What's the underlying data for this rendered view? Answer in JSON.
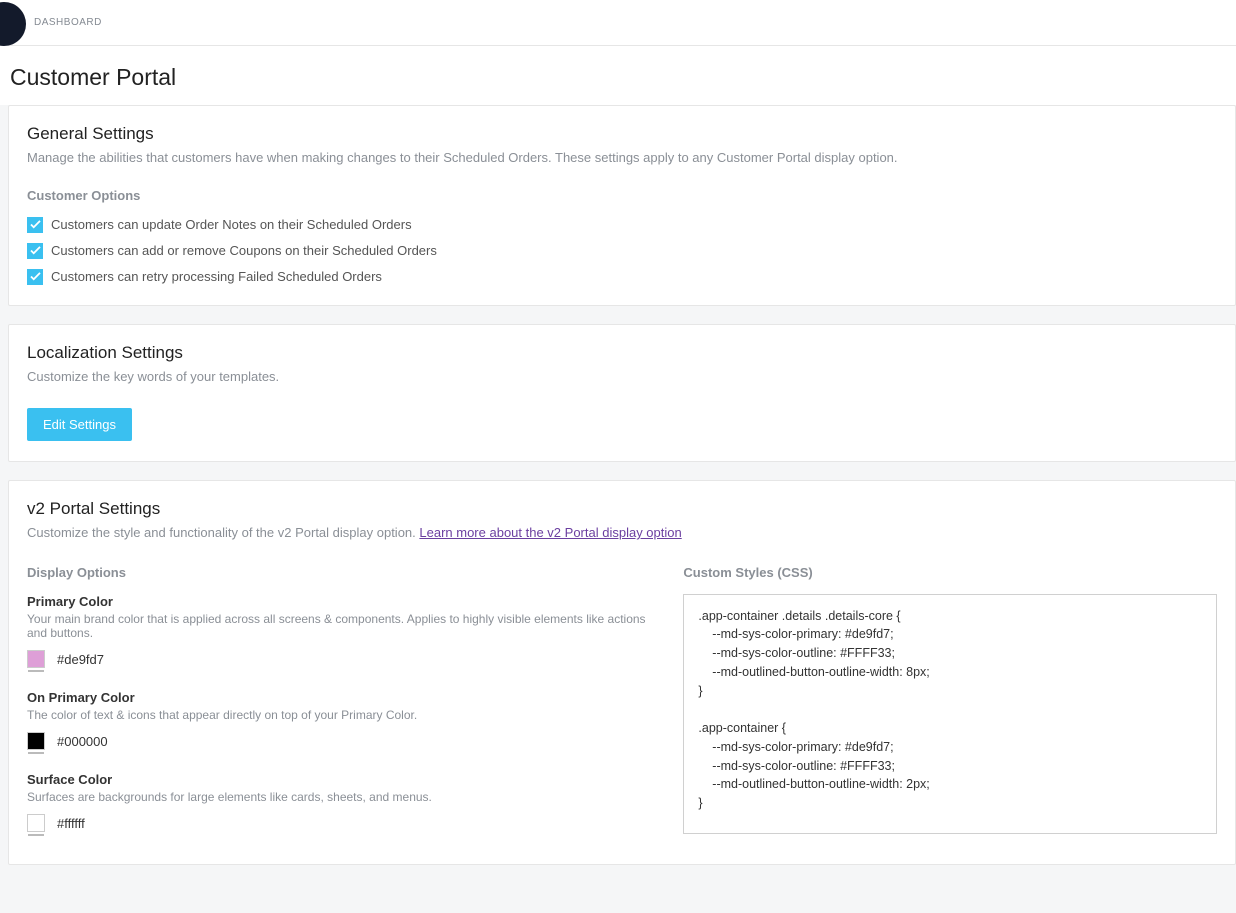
{
  "breadcrumb": "DASHBOARD",
  "page_title": "Customer Portal",
  "general": {
    "title": "General Settings",
    "subtitle": "Manage the abilities that customers have when making changes to their Scheduled Orders. These settings apply to any Customer Portal display option.",
    "section_label": "Customer Options",
    "options": [
      {
        "label": "Customers can update Order Notes on their Scheduled Orders",
        "checked": true
      },
      {
        "label": "Customers can add or remove Coupons on their Scheduled Orders",
        "checked": true
      },
      {
        "label": "Customers can retry processing Failed Scheduled Orders",
        "checked": true
      }
    ]
  },
  "localization": {
    "title": "Localization Settings",
    "subtitle": "Customize the key words of your templates.",
    "button": "Edit Settings"
  },
  "v2": {
    "title": "v2 Portal Settings",
    "subtitle_pre": "Customize the style and functionality of the v2 Portal display option. ",
    "link": "Learn more about the v2 Portal display option",
    "display_options_label": "Display Options",
    "custom_styles_label": "Custom Styles (CSS)",
    "colors": {
      "primary": {
        "label": "Primary Color",
        "desc": "Your main brand color that is applied across all screens & components. Applies to highly visible elements like actions and buttons.",
        "hex": "#de9fd7"
      },
      "on_primary": {
        "label": "On Primary Color",
        "desc": "The color of text & icons that appear directly on top of your Primary Color.",
        "hex": "#000000"
      },
      "surface": {
        "label": "Surface Color",
        "desc": "Surfaces are backgrounds for large elements like cards, sheets, and menus.",
        "hex": "#ffffff"
      }
    },
    "css": ".app-container .details .details-core {\n    --md-sys-color-primary: #de9fd7;\n    --md-sys-color-outline: #FFFF33;\n    --md-outlined-button-outline-width: 8px;\n}\n\n.app-container {\n    --md-sys-color-primary: #de9fd7;\n    --md-sys-color-outline: #FFFF33;\n    --md-outlined-button-outline-width: 2px;\n}"
  }
}
